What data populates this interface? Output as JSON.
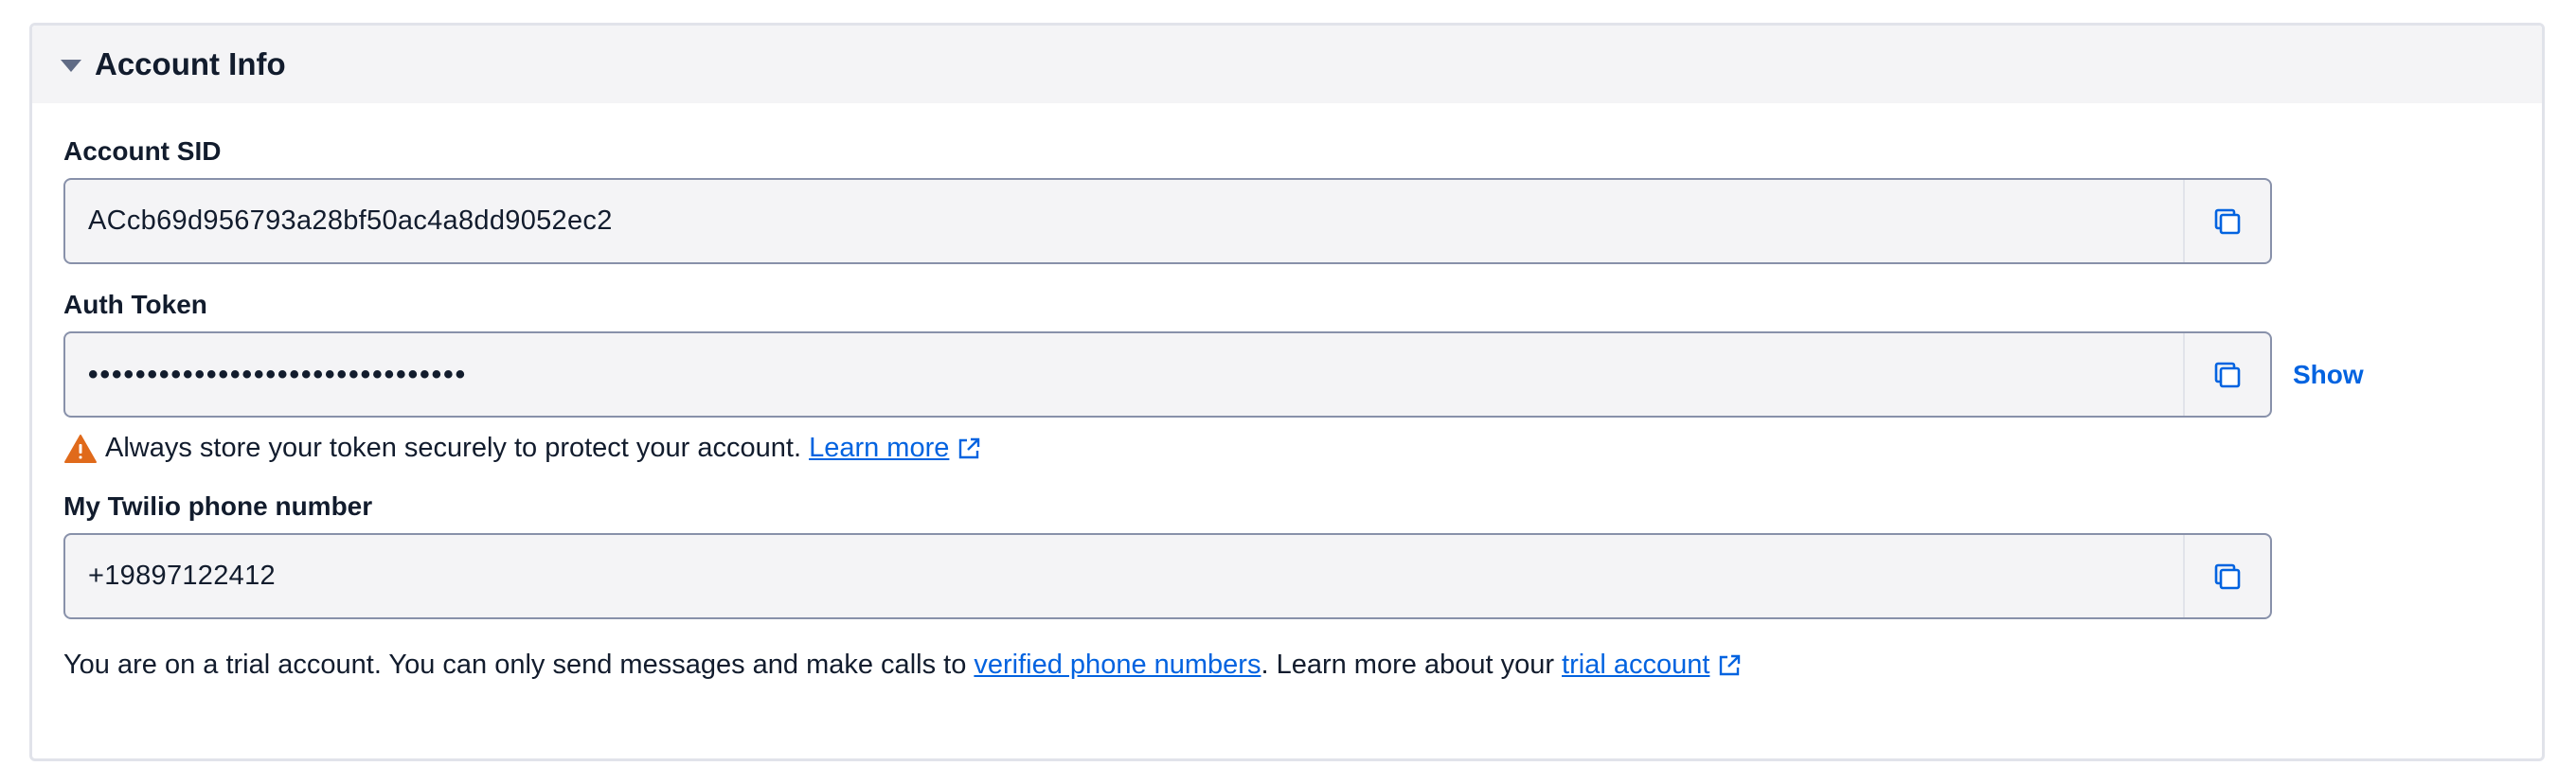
{
  "panel": {
    "title": "Account Info"
  },
  "account_sid": {
    "label": "Account SID",
    "value": "ACcb69d956793a28bf50ac4a8dd9052ec2"
  },
  "auth_token": {
    "label": "Auth Token",
    "value": "••••••••••••••••••••••••••••••••",
    "show_label": "Show"
  },
  "warning": {
    "text": "Always store your token securely to protect your account.",
    "link_text": "Learn more"
  },
  "phone": {
    "label": "My Twilio phone number",
    "value": "+19897122412"
  },
  "trial_note": {
    "text_before": "You are on a trial account. You can only send messages and make calls to",
    "link1_text": "verified phone numbers",
    "text_middle": ". Learn more about your",
    "link2_text": "trial account"
  },
  "colors": {
    "accent": "#0263e0",
    "warning": "#e06a1b",
    "header_bg": "#f4f4f6"
  },
  "icons": [
    "chevron-down-icon",
    "copy-icon",
    "warning-icon",
    "external-link-icon"
  ]
}
